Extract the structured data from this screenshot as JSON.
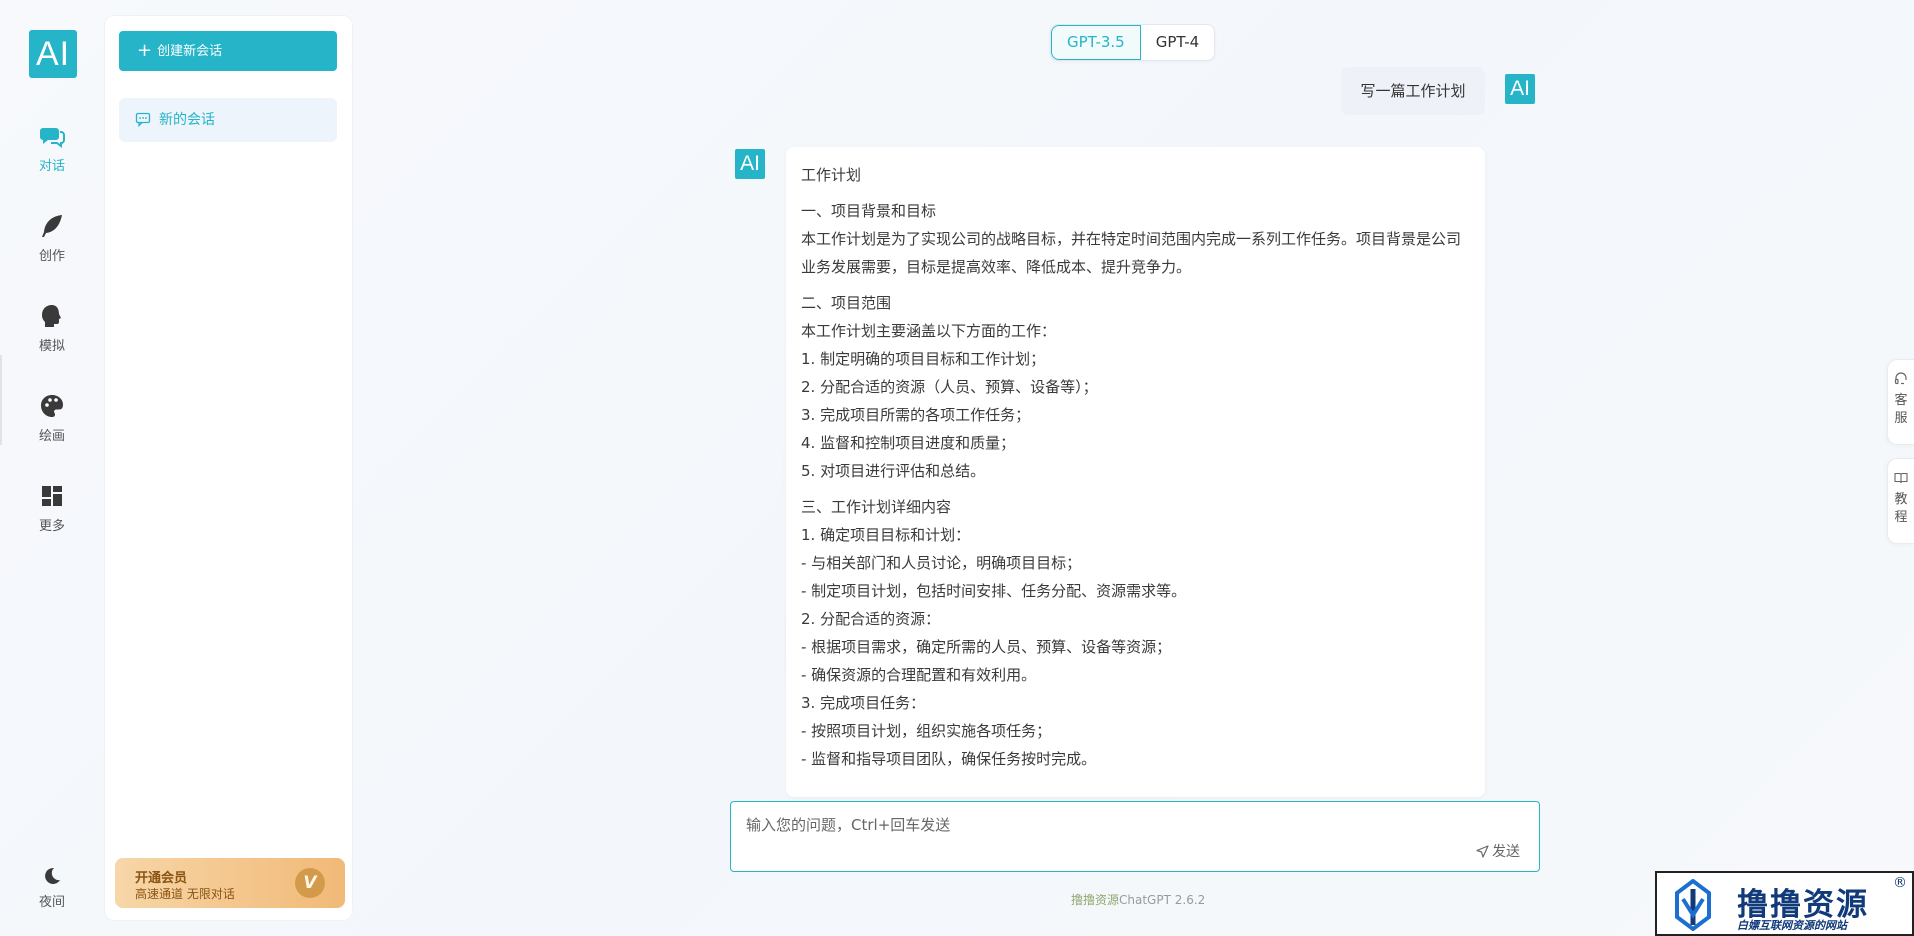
{
  "rail": {
    "logo": "AI",
    "items": [
      {
        "label": "对话",
        "icon": "chat-icon",
        "active": true
      },
      {
        "label": "创作",
        "icon": "feather-icon",
        "active": false
      },
      {
        "label": "模拟",
        "icon": "head-icon",
        "active": false
      },
      {
        "label": "绘画",
        "icon": "palette-icon",
        "active": false
      },
      {
        "label": "更多",
        "icon": "grid-icon",
        "active": false
      }
    ],
    "night": "夜间"
  },
  "sidebar": {
    "new_chat_label": "创建新会话",
    "conversations": [
      {
        "label": "新的会话"
      }
    ],
    "vip": {
      "title": "开通会员",
      "subtitle": "高速通道 无限对话",
      "badge": "V"
    }
  },
  "models": {
    "options": [
      "GPT-3.5",
      "GPT-4"
    ],
    "selected": "GPT-3.5"
  },
  "chat": {
    "user_message": "写一篇工作计划",
    "avatar_label": "AI",
    "answer": {
      "title": "工作计划",
      "sections": [
        [
          "一、项目背景和目标",
          "本工作计划是为了实现公司的战略目标，并在特定时间范围内完成一系列工作任务。项目背景是公司业务发展需要，目标是提高效率、降低成本、提升竞争力。"
        ],
        [
          "二、项目范围",
          "本工作计划主要涵盖以下方面的工作：",
          "1. 制定明确的项目目标和工作计划；",
          "2. 分配合适的资源（人员、预算、设备等）；",
          "3. 完成项目所需的各项工作任务；",
          "4. 监督和控制项目进度和质量；",
          "5. 对项目进行评估和总结。"
        ],
        [
          "三、工作计划详细内容",
          "1. 确定项目目标和计划：",
          "- 与相关部门和人员讨论，明确项目目标；",
          "- 制定项目计划，包括时间安排、任务分配、资源需求等。",
          "2. 分配合适的资源：",
          "- 根据项目需求，确定所需的人员、预算、设备等资源；",
          "- 确保资源的合理配置和有效利用。",
          "3. 完成项目任务：",
          "- 按照项目计划，组织实施各项任务；",
          "- 监督和指导项目团队，确保任务按时完成。"
        ]
      ]
    }
  },
  "input": {
    "placeholder": "输入您的问题，Ctrl+回车发送",
    "send_label": "发送"
  },
  "footer": {
    "brand": "撸撸资源",
    "version": "ChatGPT 2.6.2"
  },
  "side_tabs": [
    {
      "label": "客服",
      "icon": "headset-icon"
    },
    {
      "label": "教程",
      "icon": "book-icon"
    }
  ],
  "watermark": {
    "big": "撸撸资源",
    "small": "白嫖互联网资源的网站",
    "reg": "®"
  }
}
